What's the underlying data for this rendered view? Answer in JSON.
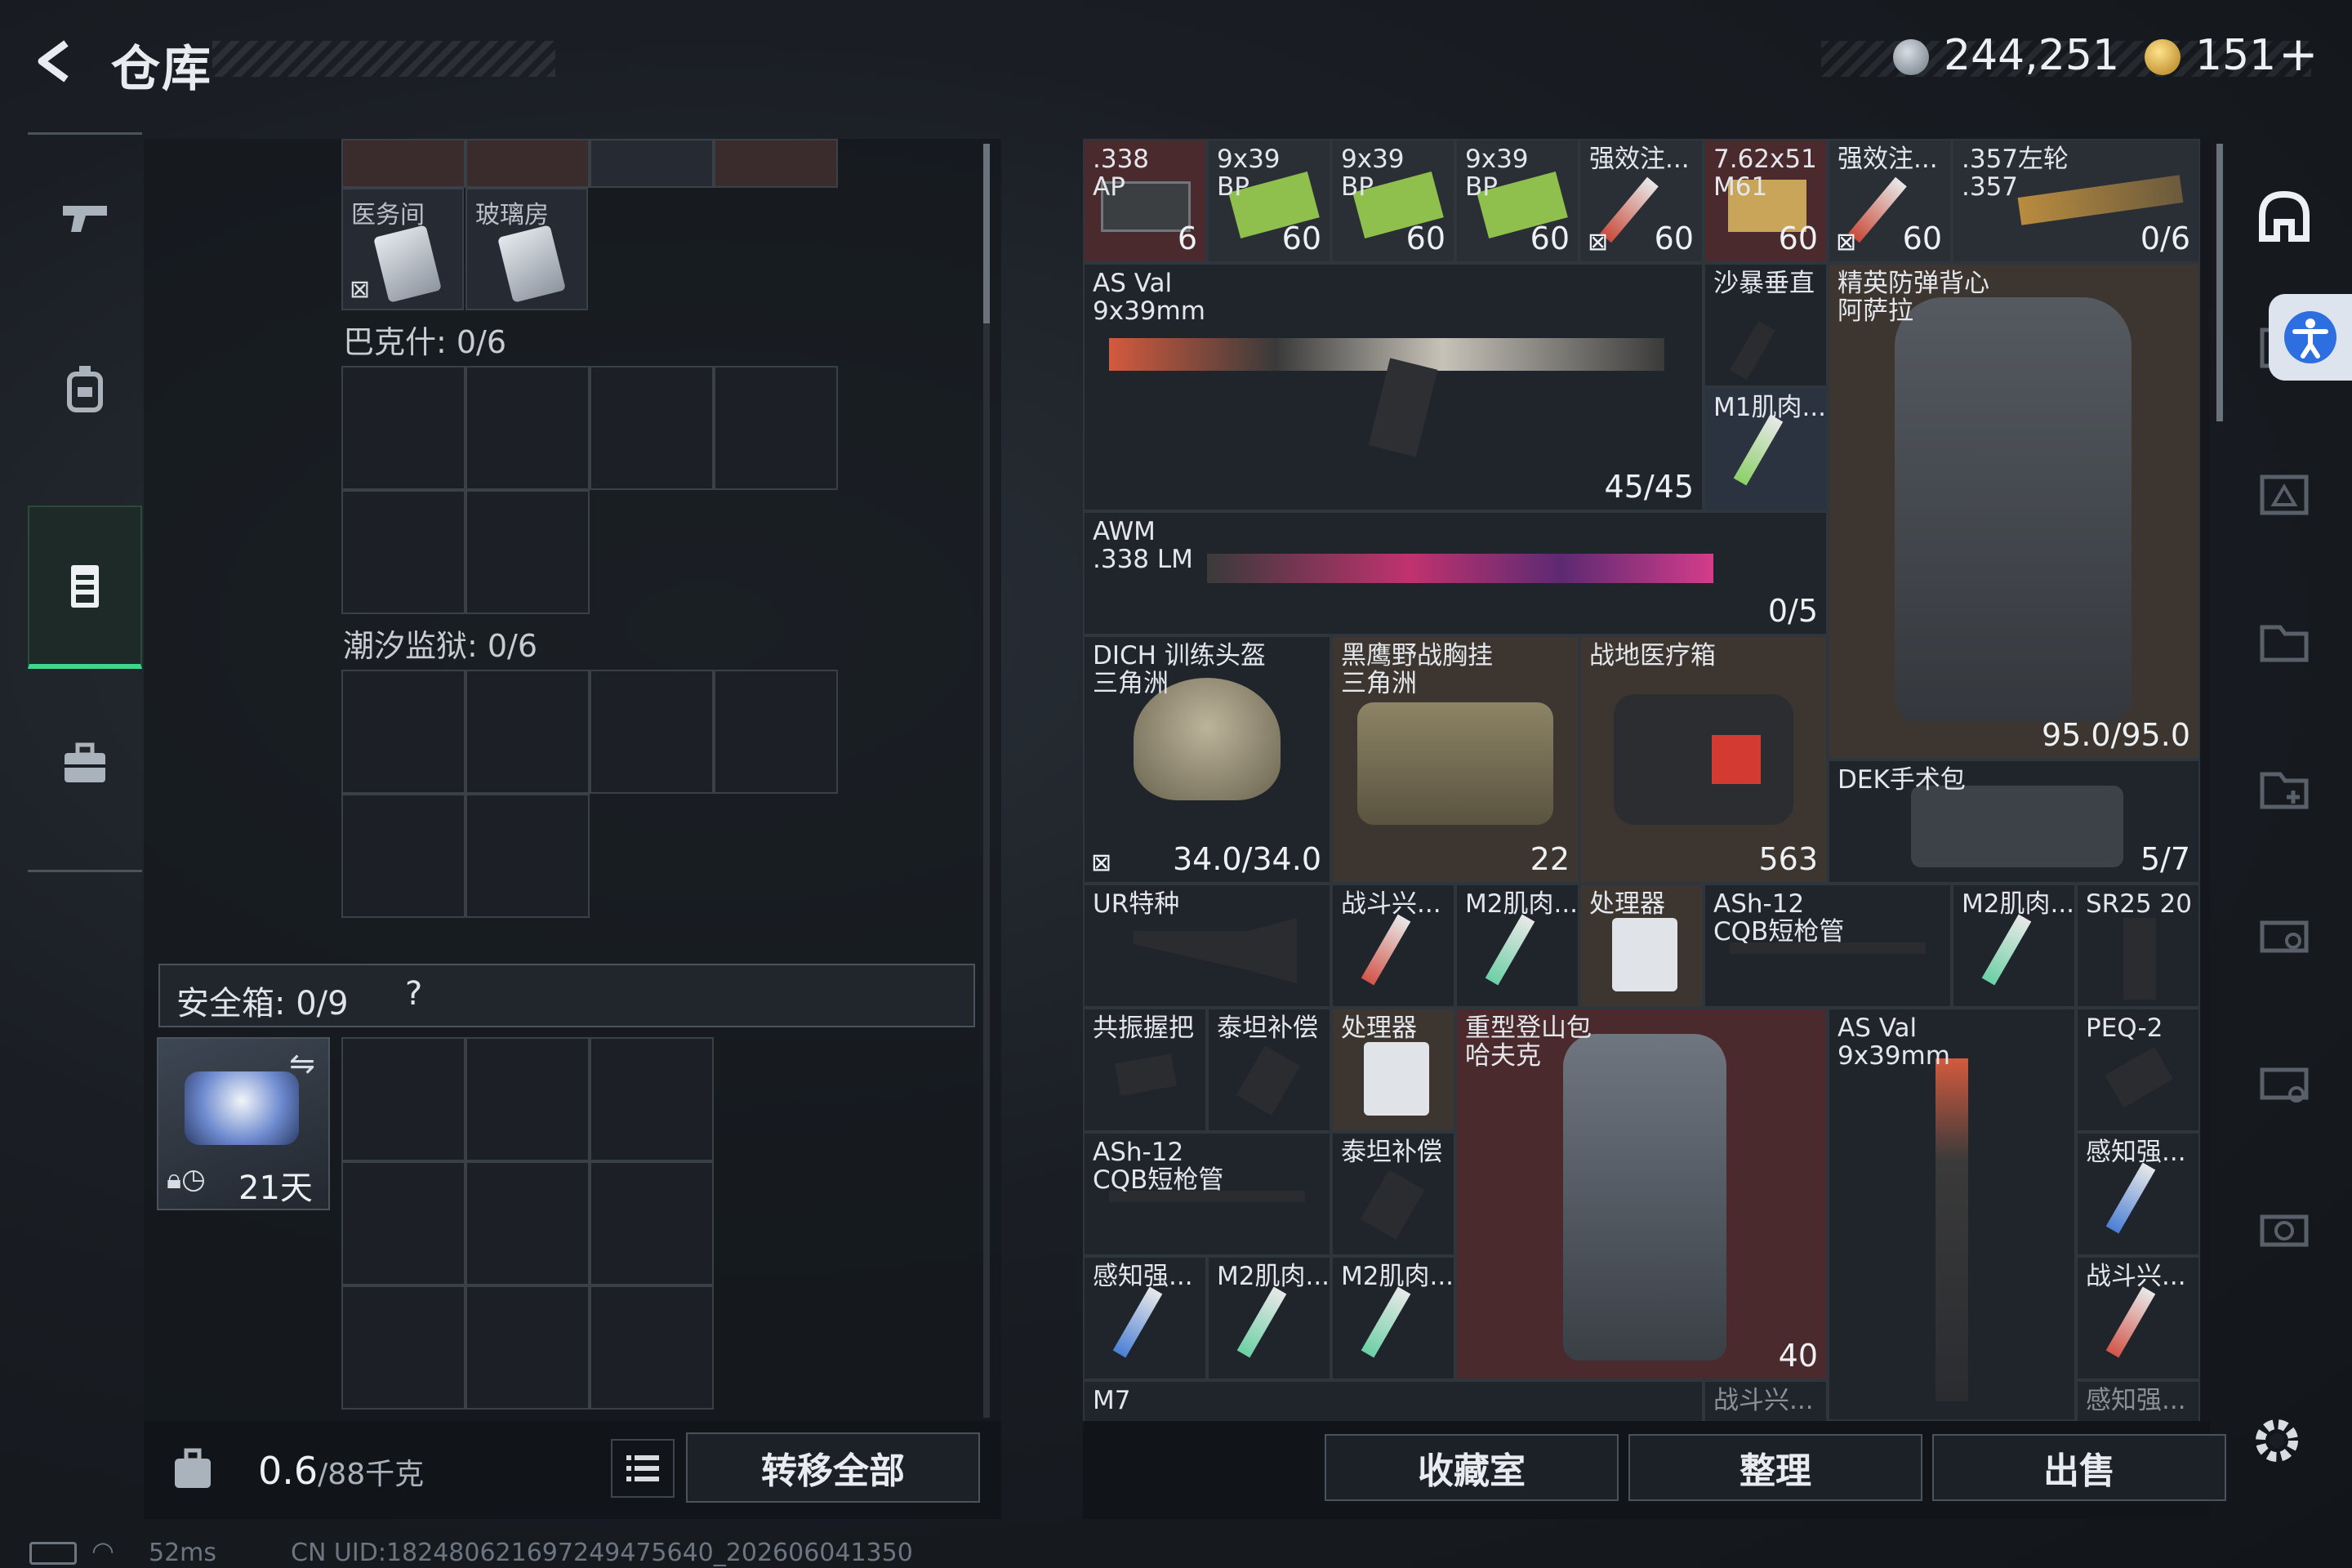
{
  "header": {
    "title": "仓库",
    "currency_silver": "244,251",
    "currency_gold": "151",
    "currency_plus": "+"
  },
  "storage": {
    "row0_labels": [
      "医务间",
      "玻璃房"
    ],
    "bakeshi_label": "巴克什: 0/6",
    "chaoxi_label": "潮汐监狱: 0/6",
    "safebox_label": "安全箱: 0/9",
    "safebox_help": "?",
    "safe_item_days": "21天",
    "weight": "0.6",
    "weight_max": "/88千克",
    "transfer_all": "转移全部"
  },
  "inventory": {
    "items": [
      {
        "name": ".338\nAP",
        "count": "6"
      },
      {
        "name": "9x39\nBP",
        "count": "60"
      },
      {
        "name": "9x39\nBP",
        "count": "60"
      },
      {
        "name": "9x39\nBP",
        "count": "60"
      },
      {
        "name": "强效注...",
        "count": "60"
      },
      {
        "name": "7.62x51\nM61",
        "count": "60"
      },
      {
        "name": "强效注...",
        "count": "60"
      },
      {
        "name": ".357左轮\n.357",
        "count": "0/6"
      },
      {
        "name": "AS Val\n9x39mm",
        "count": "45/45"
      },
      {
        "name": "沙暴垂直",
        "count": ""
      },
      {
        "name": "精英防弹背心\n阿萨拉",
        "count": "95.0/95.0"
      },
      {
        "name": "M1肌肉...",
        "count": ""
      },
      {
        "name": "AWM\n.338 LM",
        "count": "0/5"
      },
      {
        "name": "DICH 训练头盔\n三角洲",
        "count": "34.0/34.0"
      },
      {
        "name": "黑鹰野战胸挂\n三角洲",
        "count": "22"
      },
      {
        "name": "战地医疗箱",
        "count": "563"
      },
      {
        "name": "DEK手术包",
        "count": "5/7"
      },
      {
        "name": "UR特种",
        "count": ""
      },
      {
        "name": "战斗兴...",
        "count": ""
      },
      {
        "name": "M2肌肉...",
        "count": ""
      },
      {
        "name": "处理器",
        "count": ""
      },
      {
        "name": "ASh-12\nCQB短枪管",
        "count": ""
      },
      {
        "name": "M2肌肉...",
        "count": ""
      },
      {
        "name": "SR25 20",
        "count": ""
      },
      {
        "name": "共振握把",
        "count": ""
      },
      {
        "name": "泰坦补偿",
        "count": ""
      },
      {
        "name": "处理器",
        "count": ""
      },
      {
        "name": "重型登山包\n哈夫克",
        "count": "40"
      },
      {
        "name": "AS Val\n9x39mm",
        "count": ""
      },
      {
        "name": "PEQ-2",
        "count": ""
      },
      {
        "name": "ASh-12\nCQB短枪管",
        "count": ""
      },
      {
        "name": "泰坦补偿",
        "count": ""
      },
      {
        "name": "感知强...",
        "count": ""
      },
      {
        "name": "感知强...",
        "count": ""
      },
      {
        "name": "M2肌肉...",
        "count": ""
      },
      {
        "name": "M2肌肉...",
        "count": ""
      },
      {
        "name": "战斗兴...",
        "count": ""
      },
      {
        "name": "M7",
        "count": ""
      },
      {
        "name": "战斗兴...",
        "count": ""
      },
      {
        "name": "感知强...",
        "count": ""
      }
    ]
  },
  "bottom_right": {
    "collection": "收藏室",
    "organize": "整理",
    "sell": "出售"
  },
  "status": {
    "ping": "52ms",
    "uid": "CN UID:1824806216972494756​40_202606041350"
  },
  "colors": {
    "accent_green": "#3bd78b",
    "cell_red": "#4a2a2c",
    "cell_brown": "#3d3530"
  }
}
